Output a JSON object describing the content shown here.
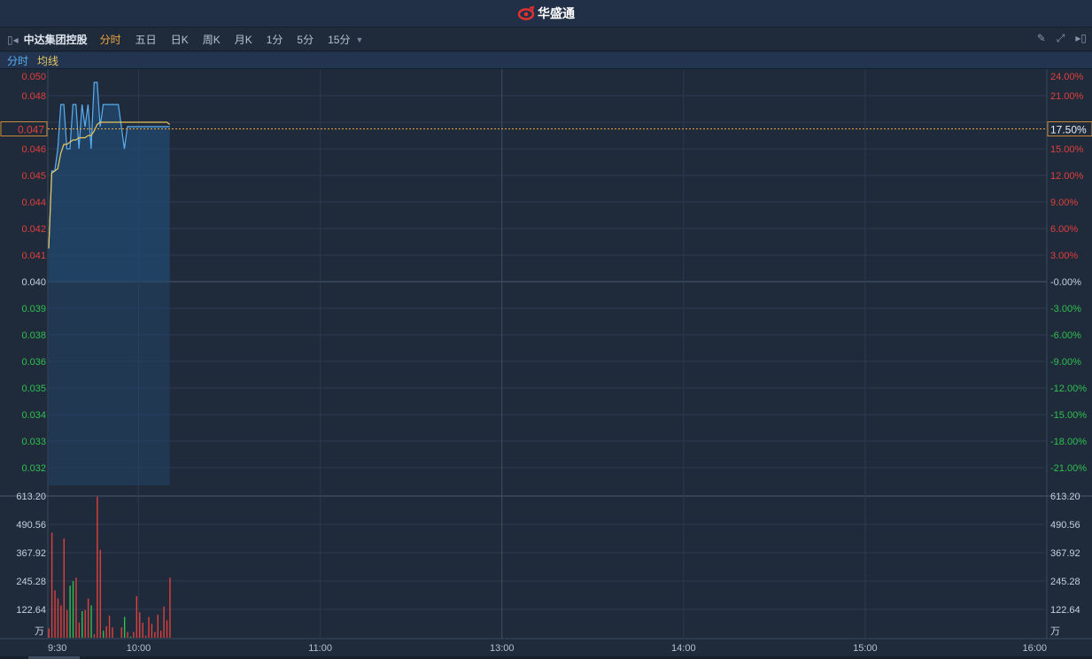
{
  "header": {
    "logo_text": "华盛通"
  },
  "toolbar": {
    "stock_name": "中达集团控股",
    "periods": [
      "分时",
      "五日",
      "日K",
      "周K",
      "月K",
      "1分",
      "5分",
      "15分"
    ],
    "active": "分时"
  },
  "legend": {
    "price_label": "分时",
    "avg_label": "均线"
  },
  "colors": {
    "up": "#e0403c",
    "down": "#30c050",
    "price_line": "#5aaef0",
    "avg_line": "#e8c860",
    "grid": "#2c3a50"
  },
  "price_axis": {
    "left": [
      "0.050",
      "0.048",
      "0.047",
      "0.046",
      "0.045",
      "0.044",
      "0.042",
      "0.041",
      "0.040",
      "0.039",
      "0.038",
      "0.036",
      "0.035",
      "0.034",
      "0.033",
      "0.032"
    ],
    "right": [
      "24.00%",
      "21.00%",
      "18.00%",
      "15.00%",
      "12.00%",
      "9.00%",
      "6.00%",
      "3.00%",
      "-0.00%",
      "-3.00%",
      "-6.00%",
      "-9.00%",
      "-12.00%",
      "-15.00%",
      "-18.00%",
      "-21.00%"
    ],
    "current_price": "0.047",
    "current_pct": "17.50%",
    "prev_close": 0.04
  },
  "volume_axis": {
    "labels": [
      "613.20",
      "490.56",
      "367.92",
      "245.28",
      "122.64"
    ],
    "unit": "万",
    "max": 613.2
  },
  "time_axis": [
    "9:30",
    "10:00",
    "11:00",
    "13:00",
    "14:00",
    "15:00",
    "16:00"
  ],
  "chart_data": {
    "type": "line",
    "price": [
      0.0415,
      0.045,
      0.045,
      0.046,
      0.048,
      0.048,
      0.046,
      0.046,
      0.048,
      0.048,
      0.046,
      0.048,
      0.047,
      0.048,
      0.046,
      0.049,
      0.049,
      0.047,
      0.048,
      0.048,
      0.048,
      0.048,
      0.048,
      0.048,
      0.047,
      0.046,
      0.047,
      0.047,
      0.047,
      0.047,
      0.047,
      0.047,
      0.047,
      0.047,
      0.047,
      0.047,
      0.047,
      0.047,
      0.047,
      0.047,
      0.047
    ],
    "avg": [
      0.0415,
      0.0449,
      0.045,
      0.0451,
      0.0458,
      0.0462,
      0.0462,
      0.0463,
      0.0464,
      0.0464,
      0.0465,
      0.0465,
      0.0465,
      0.0466,
      0.0466,
      0.0468,
      0.0471,
      0.0472,
      0.0472,
      0.0472,
      0.0472,
      0.0472,
      0.0472,
      0.0472,
      0.0472,
      0.0472,
      0.0472,
      0.0472,
      0.0472,
      0.0472,
      0.0472,
      0.0472,
      0.0472,
      0.0472,
      0.0472,
      0.0472,
      0.0472,
      0.0472,
      0.0472,
      0.0472,
      0.0471
    ],
    "volume": [
      40,
      455,
      205,
      170,
      140,
      430,
      120,
      225,
      245,
      260,
      65,
      115,
      120,
      170,
      140,
      15,
      610,
      380,
      30,
      50,
      95,
      45,
      0,
      0,
      45,
      90,
      25,
      5,
      25,
      180,
      110,
      65,
      10,
      90,
      60,
      25,
      100,
      30,
      135,
      75,
      260
    ],
    "volume_dir": [
      "u",
      "u",
      "u",
      "u",
      "u",
      "u",
      "u",
      "d",
      "d",
      "u",
      "u",
      "d",
      "u",
      "u",
      "d",
      "u",
      "u",
      "u",
      "d",
      "u",
      "u",
      "u",
      "u",
      "u",
      "u",
      "d",
      "u",
      "d",
      "u",
      "u",
      "u",
      "u",
      "u",
      "u",
      "u",
      "u",
      "u",
      "u",
      "u",
      "u",
      "u"
    ]
  }
}
